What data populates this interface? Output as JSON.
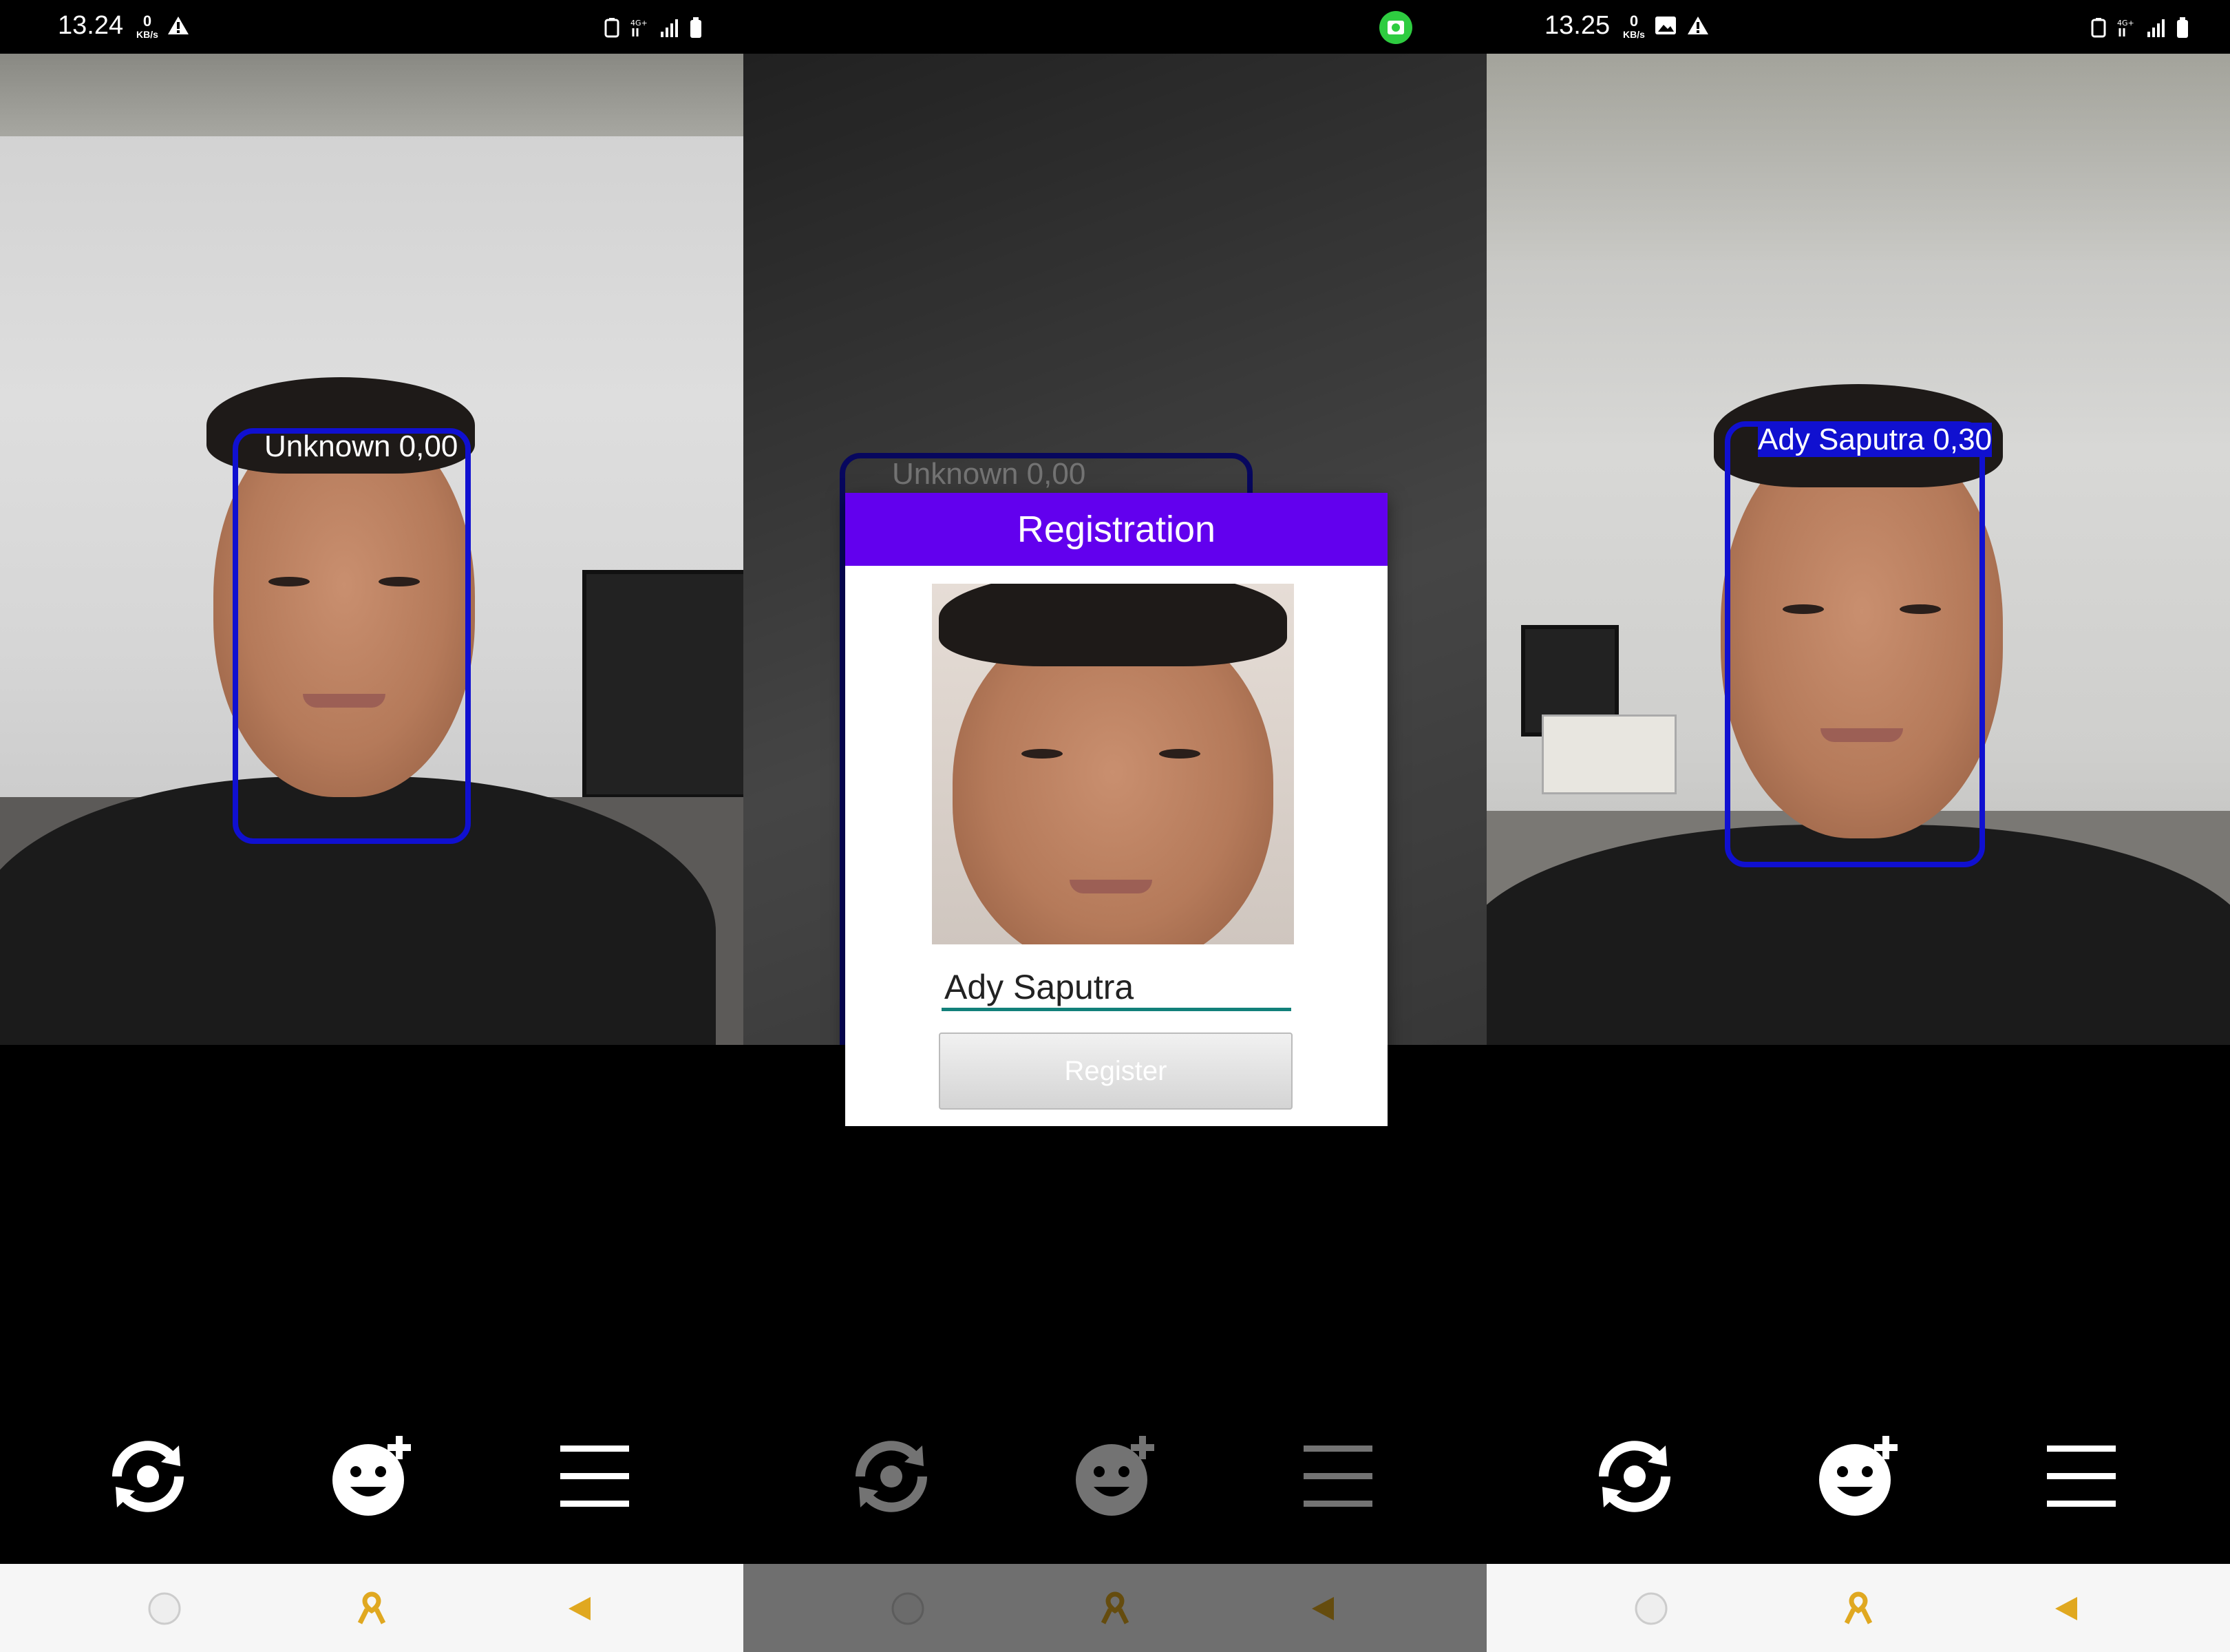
{
  "colors": {
    "face_box": "#1010d0",
    "dialog_header": "#6200ee",
    "input_underline": "#12807a",
    "nav_accent": "#e0a820",
    "record_indicator": "#2ecc40"
  },
  "panels": [
    {
      "status": {
        "time": "13.24",
        "kbs_value": "0",
        "kbs_unit": "KB/s"
      },
      "face_label": "Unknown 0,00"
    },
    {
      "status": {
        "time": "",
        "kbs_value": "",
        "kbs_unit": ""
      },
      "face_label": "Unknown 0,00",
      "dialog": {
        "title": "Registration",
        "name_value": "Ady Saputra",
        "register_label": "Register"
      }
    },
    {
      "status": {
        "time": "13.25",
        "kbs_value": "0",
        "kbs_unit": "KB/s"
      },
      "face_label": "Ady Saputra 0,30"
    }
  ],
  "toolbar_icons": [
    "switch-camera-icon",
    "add-face-icon",
    "menu-icon"
  ],
  "navbar_icons": [
    "home-icon",
    "ribbon-icon",
    "back-icon"
  ]
}
